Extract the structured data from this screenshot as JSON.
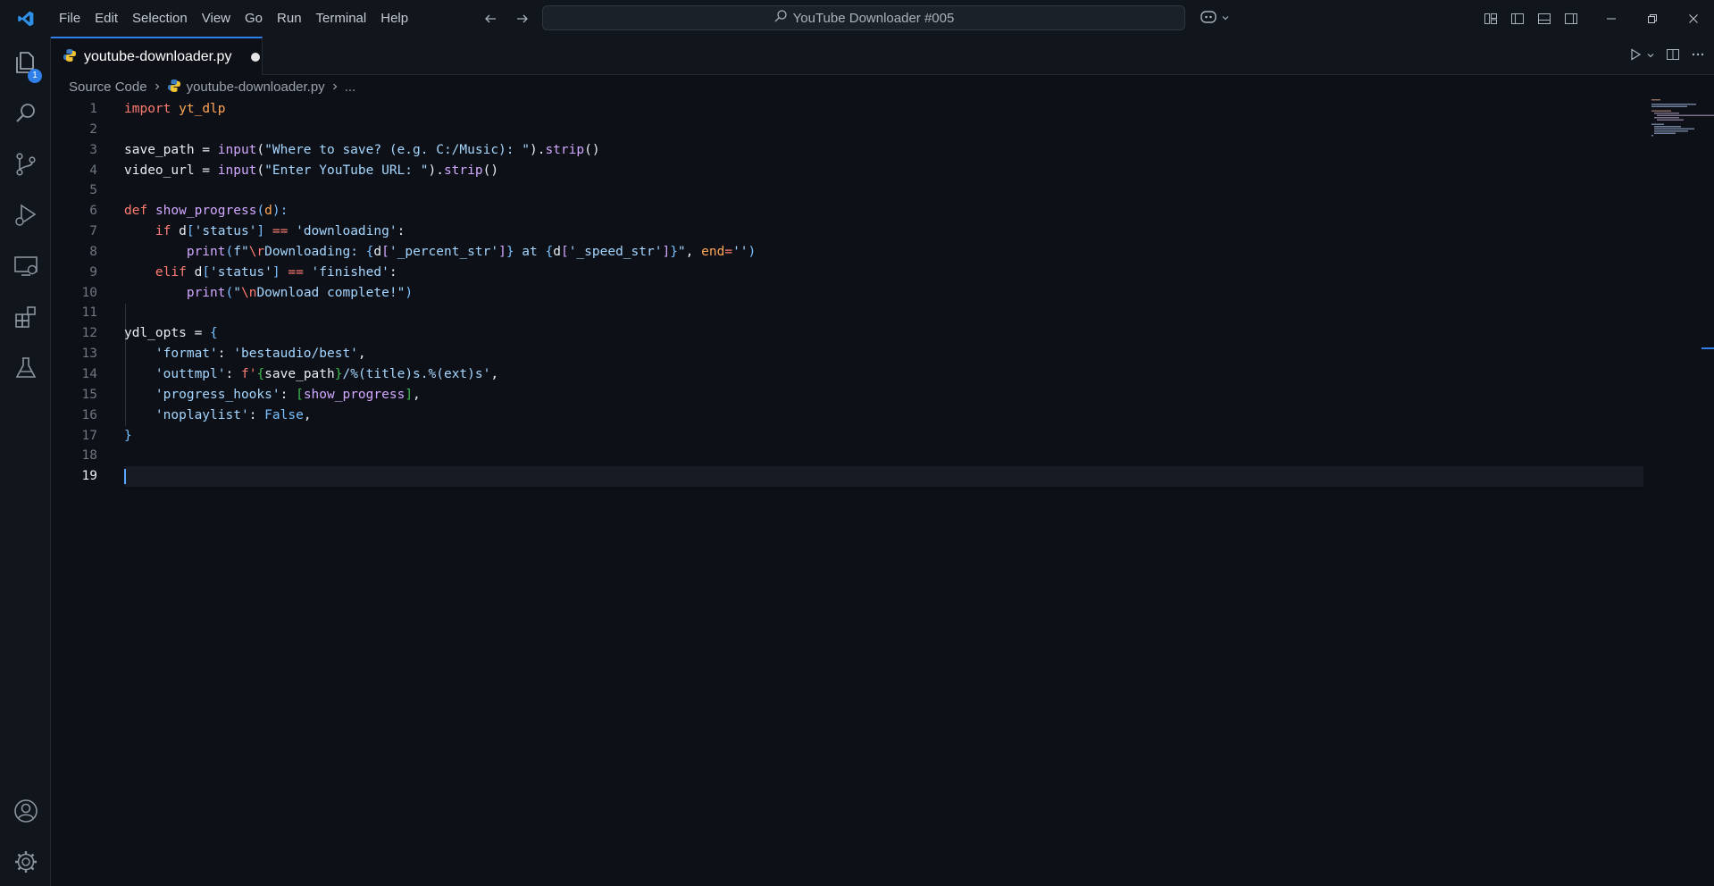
{
  "menu": [
    "File",
    "Edit",
    "Selection",
    "View",
    "Go",
    "Run",
    "Terminal",
    "Help"
  ],
  "command_center": {
    "label": "YouTube Downloader #005"
  },
  "activity": {
    "explorer_badge": "1"
  },
  "tab": {
    "label": "youtube-downloader.py"
  },
  "breadcrumb": {
    "root": "Source Code",
    "file": "youtube-downloader.py",
    "more": "..."
  },
  "line_numbers": [
    "1",
    "2",
    "3",
    "4",
    "5",
    "6",
    "7",
    "8",
    "9",
    "10",
    "11",
    "12",
    "13",
    "14",
    "15",
    "16",
    "17",
    "18",
    "19"
  ],
  "code": {
    "l1": [
      "import",
      "yt_dlp"
    ],
    "l3": [
      "save_path = ",
      "input",
      "(",
      "\"Where to save? (e.g. C:/Music): \"",
      ").",
      "strip",
      "()"
    ],
    "l4": [
      "video_url = ",
      "input",
      "(",
      "\"Enter YouTube URL: \"",
      ").",
      "strip",
      "()"
    ],
    "l6": [
      "def",
      "show_progress",
      "(",
      "d",
      "):"
    ],
    "l7": [
      "if",
      "d",
      "[",
      "'status'",
      "]",
      " == ",
      "'downloading'",
      ":"
    ],
    "l8": [
      "print",
      "(",
      "f\"",
      "\\r",
      "Downloading: ",
      "{",
      "d",
      "[",
      "'_percent_str'",
      "]",
      "}",
      " at ",
      "{",
      "d",
      "[",
      "'_speed_str'",
      "]",
      "}",
      "\"",
      ", ",
      "end",
      "=",
      "''",
      ")"
    ],
    "l9": [
      "elif",
      "d",
      "[",
      "'status'",
      "]",
      " == ",
      "'finished'",
      ":"
    ],
    "l10": [
      "print",
      "(",
      "\"",
      "\\n",
      "Download complete!\"",
      ")"
    ],
    "l12": [
      "ydl_opts = ",
      "{"
    ],
    "l13": [
      "'format'",
      ": ",
      "'bestaudio/best'",
      ","
    ],
    "l14": [
      "'outtmpl'",
      ": ",
      "f'",
      "{",
      "save_path",
      "}",
      "/%(title)s.%(ext)s'",
      ","
    ],
    "l15": [
      "'progress_hooks'",
      ": ",
      "[",
      "show_progress",
      "]",
      ","
    ],
    "l16": [
      "'noplaylist'",
      ": ",
      "False",
      ","
    ],
    "l17": [
      "}"
    ]
  },
  "colors": {
    "accent": "#2f7fe8",
    "editor_bg": "#0d1117",
    "keyword": "#ff7b72",
    "string": "#a5d6ff",
    "function": "#d2a8ff"
  },
  "icons": {
    "activity": [
      "explorer-icon",
      "search-icon",
      "source-control-icon",
      "run-debug-icon",
      "remote-explorer-icon",
      "extensions-icon",
      "testing-icon",
      "account-icon",
      "manage-gear-icon"
    ]
  }
}
